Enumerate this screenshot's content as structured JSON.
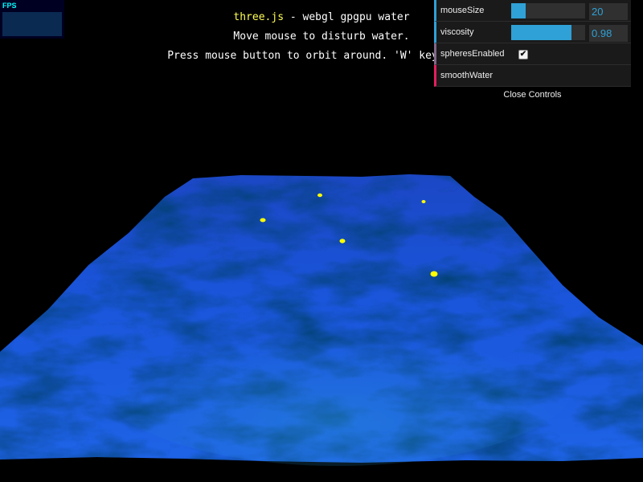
{
  "info": {
    "link_label": "three.js",
    "title_rest": " - webgl gpgpu water",
    "line2": "Move mouse to disturb water.",
    "line3": "Press mouse button to orbit around. 'W' key toggl"
  },
  "stats": {
    "label": "FPS"
  },
  "gui": {
    "controls": [
      {
        "name": "mouseSize",
        "type": "number",
        "value": "20",
        "fill": 0.2
      },
      {
        "name": "viscosity",
        "type": "number",
        "value": "0.98",
        "fill": 0.82
      },
      {
        "name": "spheresEnabled",
        "type": "boolean",
        "checked": true
      },
      {
        "name": "smoothWater",
        "type": "function"
      }
    ],
    "close_label": "Close Controls"
  },
  "colors": {
    "accent": "#2fa1d6",
    "water": "#1a4fd6",
    "sphere": "#ffff00",
    "link": "#ffff55"
  }
}
